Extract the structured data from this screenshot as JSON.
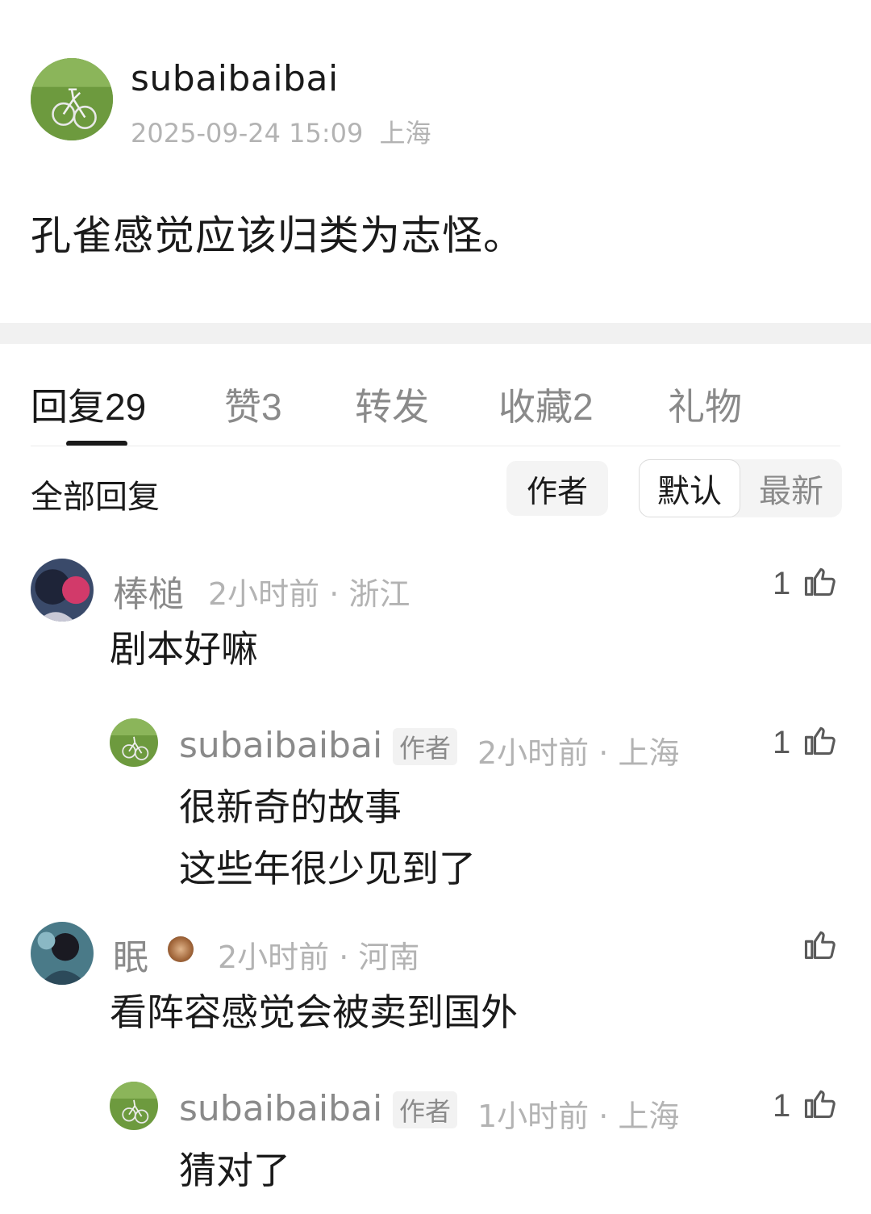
{
  "post": {
    "username": "subaibaibai",
    "timestamp": "2025-09-24 15:09",
    "location": "上海",
    "content": "孔雀感觉应该归类为志怪。"
  },
  "tabs": [
    {
      "label": "回复",
      "count": "29"
    },
    {
      "label": "赞",
      "count": "3"
    },
    {
      "label": "转发",
      "count": ""
    },
    {
      "label": "收藏",
      "count": "2"
    },
    {
      "label": "礼物",
      "count": ""
    }
  ],
  "filter": {
    "title": "全部回复",
    "author_label": "作者",
    "sort_default": "默认",
    "sort_latest": "最新"
  },
  "comments": [
    {
      "name": "棒槌",
      "meta": "2小时前 · 浙江",
      "text": "剧本好嘛",
      "likes": "1",
      "reply": {
        "name": "subaibaibai",
        "badge": "作者",
        "meta": "2小时前 · 上海",
        "text_line1": "很新奇的故事",
        "text_line2": "这些年很少见到了",
        "likes": "1"
      }
    },
    {
      "name": "眠",
      "meta": "2小时前 · 河南",
      "text": "看阵容感觉会被卖到国外",
      "likes": "",
      "reply": {
        "name": "subaibaibai",
        "badge": "作者",
        "meta": "1小时前 · 上海",
        "text_line1": "猜对了",
        "likes": "1"
      }
    }
  ],
  "icons": {
    "like": "thumbs-up-icon",
    "medal": "medal-icon"
  }
}
